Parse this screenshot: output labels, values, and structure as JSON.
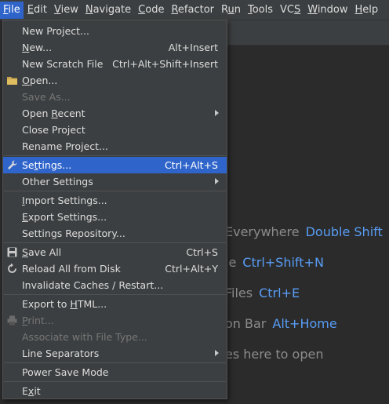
{
  "menubar": {
    "items": [
      {
        "pre": "",
        "mn": "F",
        "post": "ile",
        "active": true
      },
      {
        "pre": "",
        "mn": "E",
        "post": "dit"
      },
      {
        "pre": "",
        "mn": "V",
        "post": "iew"
      },
      {
        "pre": "",
        "mn": "N",
        "post": "avigate"
      },
      {
        "pre": "",
        "mn": "C",
        "post": "ode"
      },
      {
        "pre": "",
        "mn": "R",
        "post": "efactor"
      },
      {
        "pre": "R",
        "mn": "u",
        "post": "n"
      },
      {
        "pre": "",
        "mn": "T",
        "post": "ools"
      },
      {
        "pre": "VC",
        "mn": "S",
        "post": ""
      },
      {
        "pre": "",
        "mn": "W",
        "post": "indow"
      },
      {
        "pre": "",
        "mn": "H",
        "post": "elp"
      }
    ]
  },
  "file_menu": {
    "new_project": {
      "pre": "New Pro",
      "mn": "j",
      "post": "ect..."
    },
    "new": {
      "pre": "",
      "mn": "N",
      "post": "ew...",
      "shortcut": "Alt+Insert"
    },
    "new_scratch": {
      "label": "New Scratch File",
      "shortcut": "Ctrl+Alt+Shift+Insert"
    },
    "open": {
      "pre": "",
      "mn": "O",
      "post": "pen..."
    },
    "save_as": {
      "label": "Save As..."
    },
    "open_recent": {
      "pre": "Open ",
      "mn": "R",
      "post": "ecent"
    },
    "close_project": {
      "label": "Close Project"
    },
    "rename_project": {
      "label": "Rename Project..."
    },
    "settings": {
      "pre": "Se",
      "mn": "t",
      "post": "tings...",
      "shortcut": "Ctrl+Alt+S"
    },
    "other_settings": {
      "label": "Other Settings"
    },
    "import_settings": {
      "pre": "",
      "mn": "I",
      "post": "mport Settings..."
    },
    "export_settings": {
      "pre": "",
      "mn": "E",
      "post": "xport Settings..."
    },
    "settings_repository": {
      "label": "Settings Repository..."
    },
    "save_all": {
      "pre": "",
      "mn": "S",
      "post": "ave All",
      "shortcut": "Ctrl+S"
    },
    "reload_all": {
      "label": "Reload All from Disk",
      "shortcut": "Ctrl+Alt+Y"
    },
    "invalidate_caches": {
      "label": "Invalidate Caches / Restart..."
    },
    "export_html": {
      "pre": "Export to ",
      "mn": "H",
      "post": "TML..."
    },
    "print": {
      "pre": "",
      "mn": "P",
      "post": "rint..."
    },
    "associate": {
      "label": "Associate with File Type..."
    },
    "line_separators": {
      "label": "Line Separators"
    },
    "power_save": {
      "label": "Power Save Mode"
    },
    "exit": {
      "pre": "E",
      "mn": "x",
      "post": "it"
    }
  },
  "editor_hints": [
    {
      "text": "Everywhere",
      "key": "Double Shift"
    },
    {
      "text": "le",
      "key": "Ctrl+Shift+N"
    },
    {
      "text": "Files",
      "key": "Ctrl+E"
    },
    {
      "text": "on Bar",
      "key": "Alt+Home"
    },
    {
      "text": "es here to open",
      "key": ""
    }
  ],
  "colors": {
    "menu_bg": "#3c3f41",
    "selection": "#2f65ca",
    "editor_bg": "#2b2b2b",
    "hint_key": "#589df6"
  }
}
